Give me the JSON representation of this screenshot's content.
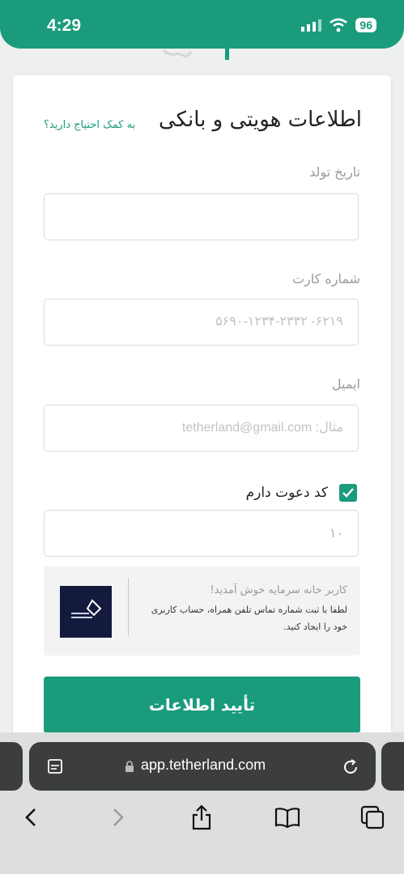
{
  "status": {
    "time": "4:29",
    "battery": "96"
  },
  "form": {
    "title": "اطلاعات هویتی و بانکی",
    "help_link": "به کمک احتیاج دارید؟",
    "birthdate": {
      "label": "تاریخ تولد",
      "value": "",
      "placeholder": ""
    },
    "card_number": {
      "label": "شماره کارت",
      "placeholder": "۶۲۱۹- ۵۶۹۰-۱۲۳۴-۲۳۳۲"
    },
    "email": {
      "label": "ایمیل",
      "placeholder": "مثال: tetherland@gmail.com"
    },
    "invite": {
      "label": "کد دعوت دارم",
      "checked": true,
      "value": "۱۰"
    },
    "promo": {
      "title": "کاربر خانه سرمایه خوش آمدید!",
      "body": "لطفا با ثبت شماره تماس تلفن همراه، حساب کاربری خود را ایجاد کنید."
    },
    "submit_label": "تأیید اطلاعات"
  },
  "browser": {
    "url": "app.tetherland.com"
  },
  "colors": {
    "accent": "#1a9b7c",
    "promo_logo_bg": "#131a3d"
  }
}
